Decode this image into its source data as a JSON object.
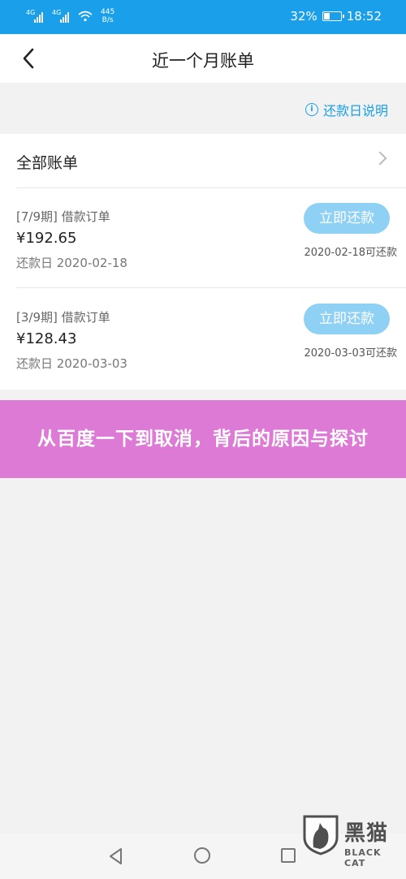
{
  "status_bar": {
    "signal1": "4G",
    "signal2": "4G",
    "speed_value": "445",
    "speed_unit": "B/s",
    "battery": "32%",
    "time": "18:52",
    "battery_level": 0.32
  },
  "nav": {
    "title": "近一个月账单"
  },
  "info_link": {
    "label": "还款日说明"
  },
  "bill_list": {
    "all_label": "全部账单",
    "items": [
      {
        "period": "[7/9期] 借款订单",
        "amount": "¥192.65",
        "due": "还款日 2020-02-18",
        "button": "立即还款",
        "payable": "2020-02-18可还款"
      },
      {
        "period": "[3/9期] 借款订单",
        "amount": "¥128.43",
        "due": "还款日 2020-03-03",
        "button": "立即还款",
        "payable": "2020-03-03可还款"
      }
    ]
  },
  "banner": {
    "text": "从百度一下到取消，背后的原因与探讨"
  },
  "watermark": {
    "cn": "黑猫",
    "en": "BLACK CAT"
  },
  "colors": {
    "accent": "#1aa0ea",
    "button_disabled": "#8fd0f5",
    "banner": "#dd7ad6"
  }
}
